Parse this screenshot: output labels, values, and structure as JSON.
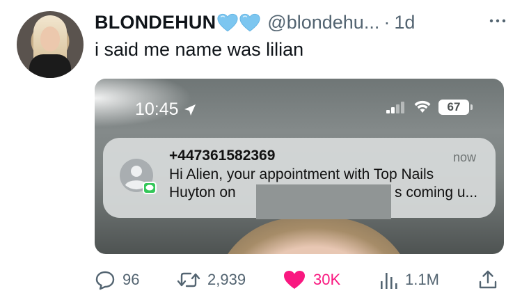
{
  "tweet": {
    "author_name": "BLONDEHUN",
    "badges": [
      "light-blue-heart-icon",
      "light-blue-heart-icon"
    ],
    "handle": "@blondehu...",
    "separator": "·",
    "time": "1d",
    "text": "i said me name was lilian"
  },
  "screenshot": {
    "status_time": "10:45",
    "battery": "67",
    "notification": {
      "sender": "+447361582369",
      "time": "now",
      "line1": "Hi Alien, your appointment with Top Nails",
      "line2_start": "Huyton on",
      "line2_end": "s coming u..."
    }
  },
  "actions": {
    "replies": "96",
    "retweets": "2,939",
    "likes": "30K",
    "views": "1.1M"
  },
  "colors": {
    "badge": "#7cc6f0",
    "like": "#f91880",
    "muted": "#536471",
    "imessage_green": "#34c759"
  }
}
